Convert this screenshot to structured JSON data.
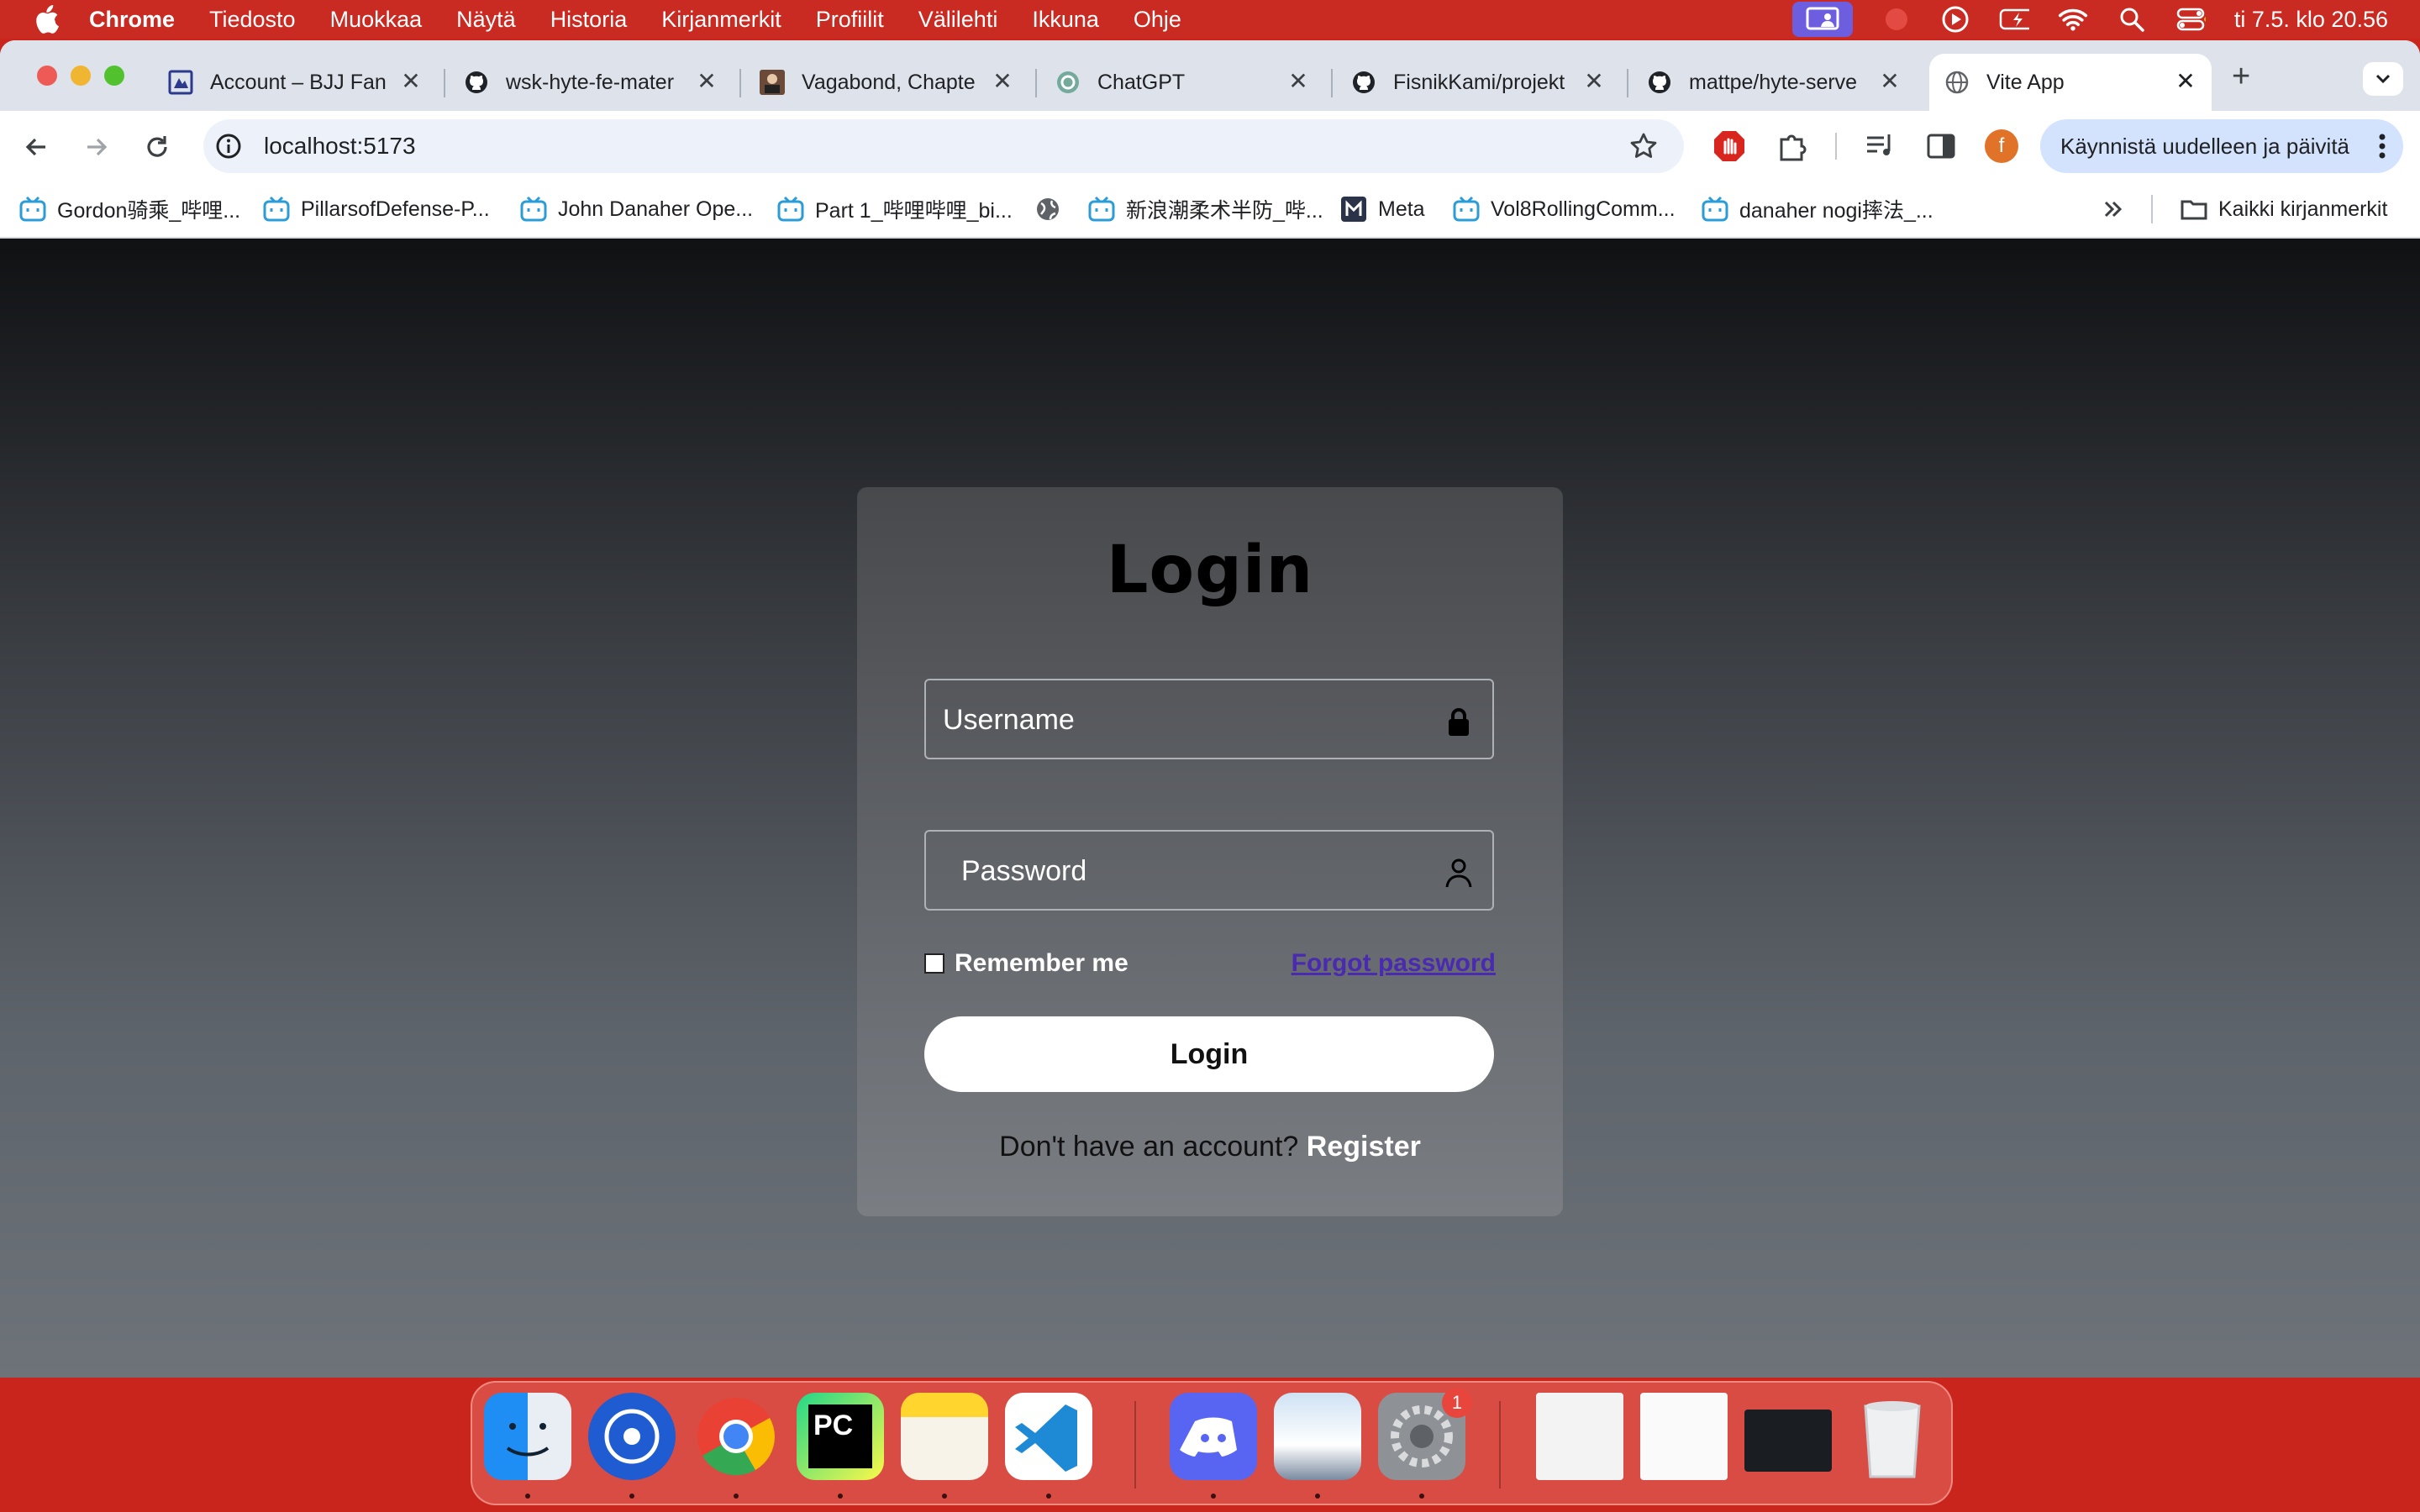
{
  "menubar": {
    "items": [
      "Chrome",
      "Tiedosto",
      "Muokkaa",
      "Näytä",
      "Historia",
      "Kirjanmerkit",
      "Profiilit",
      "Välilehti",
      "Ikkuna",
      "Ohje"
    ],
    "clock": "ti 7.5. klo 20.56"
  },
  "tabs": [
    {
      "title": "Account – BJJ Fan",
      "icon": "bjj-favicon"
    },
    {
      "title": "wsk-hyte-fe-mater",
      "icon": "github-icon"
    },
    {
      "title": "Vagabond, Chapte",
      "icon": "manga-favicon"
    },
    {
      "title": "ChatGPT",
      "icon": "chatgpt-icon"
    },
    {
      "title": "FisnikKami/projekt",
      "icon": "github-icon"
    },
    {
      "title": "mattpe/hyte-serve",
      "icon": "github-icon"
    },
    {
      "title": "Vite App",
      "icon": "globe-icon",
      "active": true
    }
  ],
  "toolbar": {
    "url": "localhost:5173",
    "profile_initial": "f",
    "update_button": "Käynnistä uudelleen ja päivitä"
  },
  "bookmarks": {
    "items": [
      "Gordon骑乘_哔哩...",
      "PillarsofDefense-P...",
      "John Danaher Ope...",
      "Part 1_哔哩哔哩_bi...",
      "",
      "新浪潮柔术半防_哔...",
      "Meta",
      "Vol8RollingComm...",
      "danaher nogi摔法_..."
    ],
    "all_bookmarks": "Kaikki kirjanmerkit"
  },
  "login": {
    "title": "Login",
    "username_placeholder": "Username",
    "password_placeholder": "Password",
    "remember_me": "Remember me",
    "forgot_password": "Forgot password",
    "login_button": "Login",
    "no_account": "Don't have an account?",
    "register": "Register"
  },
  "dock": {
    "apps": [
      "finder",
      "kodi",
      "chrome",
      "pycharm",
      "notes",
      "vscode",
      "discord",
      "preview",
      "system-settings",
      "document-1",
      "document-2",
      "terminal-vscode",
      "trash"
    ],
    "settings_badge": "1"
  },
  "colors": {
    "menubar": "#c92a22",
    "tabstrip": "#dee3eb",
    "link": "#4a2ab0",
    "update_button_bg": "#d3e3fd"
  }
}
